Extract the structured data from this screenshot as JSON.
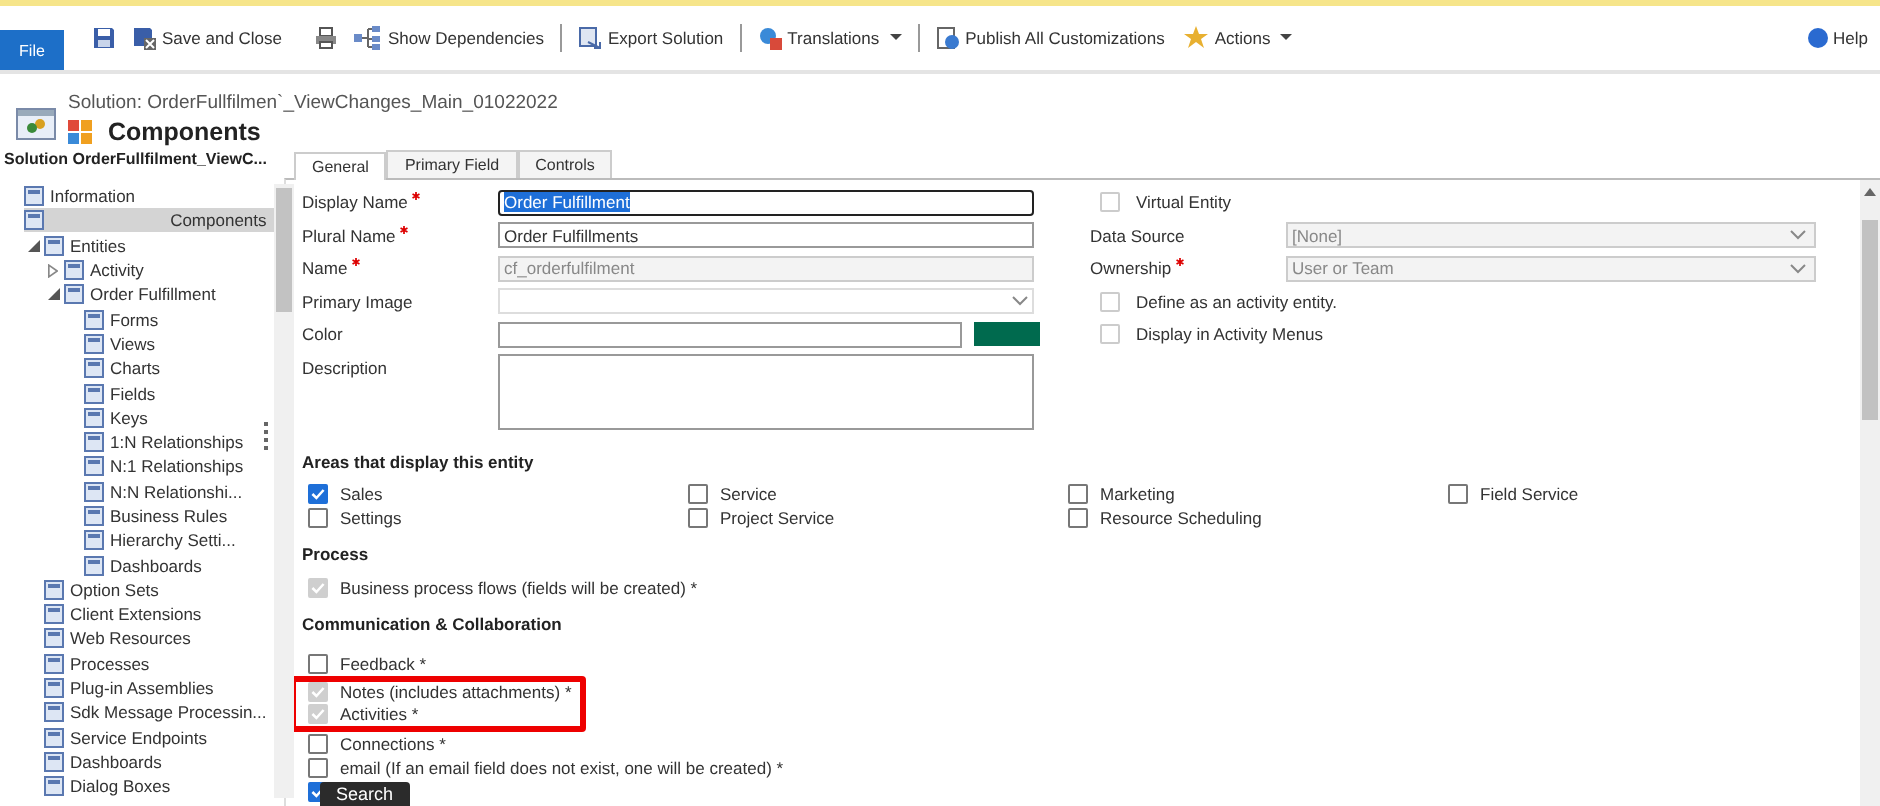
{
  "toolbar": {
    "file_button": "File",
    "groups": [
      [
        {
          "label": "Save and Close",
          "dropdown": false
        },
        {
          "label": "Show Dependencies",
          "dropdown": false
        }
      ],
      [
        {
          "label": "Export Solution",
          "dropdown": false
        }
      ],
      [
        {
          "label": "Translations",
          "dropdown": true
        }
      ],
      [
        {
          "label": "Publish All Customizations",
          "dropdown": false
        },
        {
          "label": "Actions",
          "dropdown": true
        }
      ]
    ],
    "help": "Help"
  },
  "header": {
    "solution": "Solution: OrderFullfilmen`_ViewChanges_Main_01022022",
    "title": "Components"
  },
  "sidebar": {
    "title": "Solution OrderFullfilment_ViewC...",
    "items": [
      {
        "label": "Information",
        "selected": false
      },
      {
        "label": "Components",
        "selected": true,
        "children": [
          {
            "label": "Entities",
            "selected": false,
            "expanded": true,
            "children": [
              {
                "label": "Activity",
                "selected": false,
                "expanded": false
              },
              {
                "label": "Order Fulfillment",
                "selected": false,
                "expanded": true,
                "children": [
                  {
                    "label": "Forms",
                    "selected": false
                  },
                  {
                    "label": "Views",
                    "selected": false
                  },
                  {
                    "label": "Charts",
                    "selected": false
                  },
                  {
                    "label": "Fields",
                    "selected": false
                  },
                  {
                    "label": "Keys",
                    "selected": false
                  },
                  {
                    "label": "1:N Relationships",
                    "selected": false
                  },
                  {
                    "label": "N:1 Relationships",
                    "selected": false
                  },
                  {
                    "label": "N:N Relationshi...",
                    "selected": false
                  },
                  {
                    "label": "Business Rules",
                    "selected": false
                  },
                  {
                    "label": "Hierarchy Setti...",
                    "selected": false
                  },
                  {
                    "label": "Dashboards",
                    "selected": false
                  }
                ]
              }
            ]
          },
          {
            "label": "Option Sets",
            "selected": false
          },
          {
            "label": "Client Extensions",
            "selected": false
          },
          {
            "label": "Web Resources",
            "selected": false
          },
          {
            "label": "Processes",
            "selected": false
          },
          {
            "label": "Plug-in Assemblies",
            "selected": false
          },
          {
            "label": "Sdk Message Processin...",
            "selected": false
          },
          {
            "label": "Service Endpoints",
            "selected": false
          },
          {
            "label": "Dashboards",
            "selected": false
          },
          {
            "label": "Dialog Boxes",
            "selected": false
          }
        ]
      }
    ]
  },
  "tabs": [
    {
      "label": "General",
      "selected": true
    },
    {
      "label": "Primary Field",
      "selected": false
    },
    {
      "label": "Controls",
      "selected": false
    }
  ],
  "general": {
    "left_fields": [
      {
        "kind": "text",
        "label": "Display Name",
        "required": true,
        "value": "Order Fulfillment",
        "disabled": false,
        "text_selected": true
      },
      {
        "kind": "text",
        "label": "Plural Name",
        "required": true,
        "value": "Order Fulfillments",
        "disabled": false,
        "text_selected": false
      },
      {
        "kind": "text",
        "label": "Name",
        "required": true,
        "value": "cf_orderfulfilment",
        "disabled": true,
        "text_selected": false
      },
      {
        "kind": "select",
        "label": "Primary Image",
        "required": false,
        "disabled": false
      },
      {
        "kind": "color",
        "label": "Color",
        "required": false,
        "color": "#006a4e"
      },
      {
        "kind": "textarea",
        "label": "Description",
        "required": false
      }
    ],
    "right_fields": [
      {
        "kind": "checkbox",
        "label": "Virtual Entity",
        "checked": false,
        "disabled": true
      },
      {
        "kind": "select",
        "label": "Data Source",
        "required": false,
        "value": "[None]",
        "disabled": true
      },
      {
        "kind": "select",
        "label": "Ownership",
        "required": true,
        "value": "User or Team",
        "disabled": true
      },
      {
        "kind": "checkbox",
        "label": "Define as an activity entity.",
        "checked": false,
        "disabled": true,
        "children": [
          {
            "kind": "checkbox",
            "label": "Display in Activity Menus",
            "checked": false,
            "disabled": true
          }
        ]
      }
    ],
    "areas": {
      "heading": "Areas that display this entity",
      "options": [
        {
          "label": "Sales",
          "checked": true,
          "disabled": false
        },
        {
          "label": "Service",
          "checked": false,
          "disabled": false
        },
        {
          "label": "Marketing",
          "checked": false,
          "disabled": false
        },
        {
          "label": "Field Service",
          "checked": false,
          "disabled": false
        },
        {
          "label": "Settings",
          "checked": false,
          "disabled": false
        },
        {
          "label": "Project Service",
          "checked": false,
          "disabled": false
        },
        {
          "label": "Resource Scheduling",
          "checked": false,
          "disabled": false
        }
      ]
    },
    "process": {
      "heading": "Process",
      "options": [
        {
          "label": "Business process flows (fields will be created) *",
          "checked": true,
          "disabled": true
        }
      ]
    },
    "communication": {
      "heading": "Communication & Collaboration",
      "options": [
        {
          "label": "Feedback *",
          "checked": false,
          "disabled": false
        },
        {
          "label": "Notes (includes attachments) *",
          "checked": true,
          "disabled": true,
          "highlighted": true
        },
        {
          "label": "Activities *",
          "checked": true,
          "disabled": true,
          "highlighted": true
        },
        {
          "label": "Connections *",
          "checked": false,
          "disabled": false
        },
        {
          "label": "email (If an email field does not exist, one will be created) *",
          "checked": false,
          "disabled": false
        },
        {
          "checked": true,
          "disabled": false
        }
      ]
    }
  },
  "tooltip": "Search"
}
